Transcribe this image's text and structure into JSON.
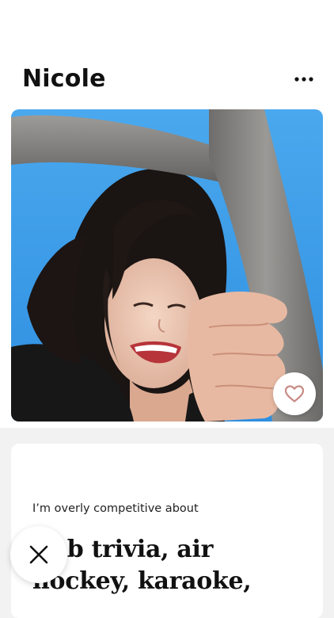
{
  "profile": {
    "name": "Nicole",
    "more_icon": "more-horizontal-icon"
  },
  "photo": {
    "description_icon": "profile-photo",
    "like_icon": "heart-outline-icon"
  },
  "prompt": {
    "question": "I’m overly competitive about",
    "answer": "Pub trivia, air hockey, karaoke,"
  },
  "actions": {
    "skip_icon": "close-icon"
  },
  "colors": {
    "sky": "#3d9fe8",
    "pipe": "#8a8a88",
    "heart_stroke": "#c98a85",
    "text": "#111111"
  }
}
